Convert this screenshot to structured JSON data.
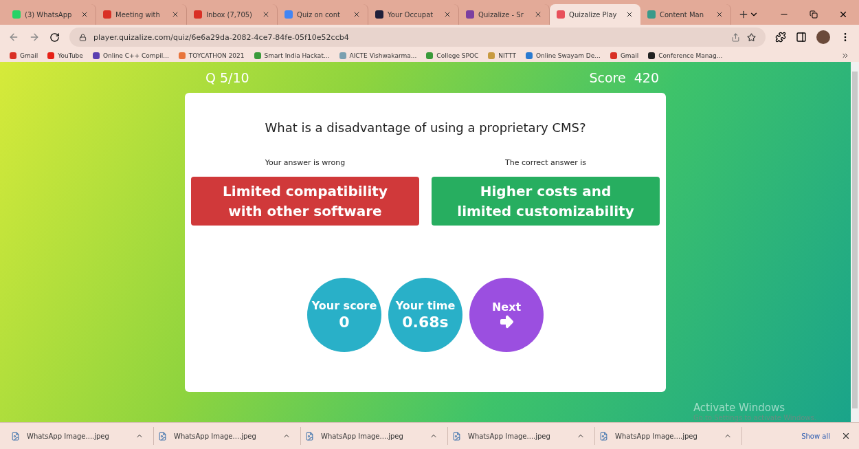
{
  "tabs": [
    {
      "title": "(3) WhatsApp",
      "selected": false,
      "color": "#25d366"
    },
    {
      "title": "Meeting with",
      "selected": false,
      "color": "#d93025"
    },
    {
      "title": "Inbox (7,705)",
      "selected": false,
      "color": "#d93025"
    },
    {
      "title": "Quiz on cont",
      "selected": false,
      "color": "#4285f4"
    },
    {
      "title": "Your Occupat",
      "selected": false,
      "color": "#1f1f3a"
    },
    {
      "title": "Quizalize - Sr",
      "selected": false,
      "color": "#7b3fa0"
    },
    {
      "title": "Quizalize Play",
      "selected": true,
      "color": "#e8505b"
    },
    {
      "title": "Content Man",
      "selected": false,
      "color": "#3a9a8a"
    }
  ],
  "address": {
    "url": "player.quizalize.com/quiz/6e6a29da-2082-4ce7-84fe-05f10e52ccb4"
  },
  "bookmarks": [
    {
      "label": "Gmail",
      "color": "#d93025"
    },
    {
      "label": "YouTube",
      "color": "#e62117"
    },
    {
      "label": "Online C++ Compil...",
      "color": "#5b3fb0"
    },
    {
      "label": "TOYCATHON 2021",
      "color": "#e8743b"
    },
    {
      "label": "Smart India Hackat...",
      "color": "#3a9a3a"
    },
    {
      "label": "AICTE Vishwakarma...",
      "color": "#7aa0b0"
    },
    {
      "label": "College SPOC",
      "color": "#3a9a3a"
    },
    {
      "label": "NITTT",
      "color": "#c89a40"
    },
    {
      "label": "Online Swayam De...",
      "color": "#2a7ad0"
    },
    {
      "label": "Gmail",
      "color": "#d93025"
    },
    {
      "label": "Conference Manag...",
      "color": "#222222"
    }
  ],
  "quiz": {
    "counter": "Q 5/10",
    "score_label": "Score",
    "score_value": "420",
    "question": "What is a disadvantage of using a proprietary CMS?",
    "answers": [
      {
        "caption": "Your answer is wrong",
        "text": "Limited compatibility with other software",
        "kind": "wrong"
      },
      {
        "caption": "The correct answer is",
        "text": "Higher costs and limited customizability",
        "kind": "correct"
      }
    ],
    "stats": [
      {
        "label": "Your score",
        "value": "0",
        "kind": "stat"
      },
      {
        "label": "Your time",
        "value": "0.68s",
        "kind": "stat"
      },
      {
        "label": "Next",
        "kind": "next"
      }
    ]
  },
  "downloads": [
    {
      "name": "WhatsApp Image....jpeg"
    },
    {
      "name": "WhatsApp Image....jpeg"
    },
    {
      "name": "WhatsApp Image....jpeg"
    },
    {
      "name": "WhatsApp Image....jpeg"
    },
    {
      "name": "WhatsApp Image....jpeg"
    }
  ],
  "show_all": "Show all",
  "activation": {
    "title": "Activate Windows",
    "hint": "Go to Settings to activate Windows."
  }
}
